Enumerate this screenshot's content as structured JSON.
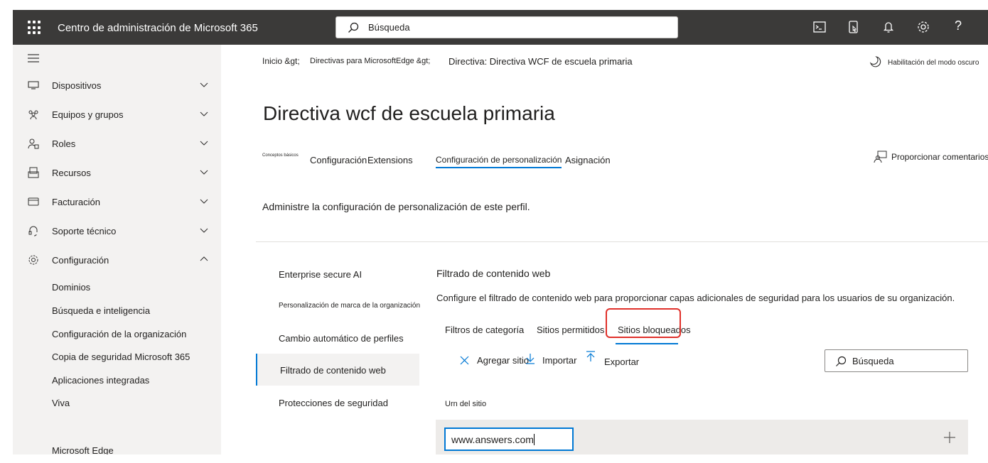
{
  "header": {
    "app_title": "Centro de administración de Microsoft 365",
    "search_placeholder": "Búsqueda",
    "icons": [
      "waffle-icon",
      "terminal-icon",
      "mobile-icon",
      "bell-icon",
      "gear-icon",
      "help-icon"
    ],
    "help_glyph": "?"
  },
  "nav": {
    "items": [
      {
        "label": "Dispositivos",
        "icon": "device-icon"
      },
      {
        "label": "Equipos y grupos",
        "icon": "group-icon"
      },
      {
        "label": "Roles",
        "icon": "roles-icon"
      },
      {
        "label": "Recursos",
        "icon": "resources-icon"
      },
      {
        "label": "Facturación",
        "icon": "billing-icon"
      },
      {
        "label": "Soporte técnico",
        "icon": "headset-icon"
      },
      {
        "label": "Configuración",
        "icon": "gear-icon"
      }
    ],
    "sub_items": [
      "Dominios",
      "Búsqueda e inteligencia",
      "Configuración de la organización",
      "Copia de seguridad Microsoft 365",
      "Aplicaciones integradas",
      "Viva",
      "Microsoft Edge"
    ]
  },
  "breadcrumb": {
    "home": "Inicio &gt;",
    "policies": "Directivas para MicrosoftEdge &gt;",
    "current": "Directiva: Directiva WCF de escuela primaria"
  },
  "dark_mode_label": "Habilitación del modo oscuro",
  "page_title": "Directiva wcf de escuela primaria",
  "tabs": {
    "basics": "Conceptos básicos",
    "settings": "Configuración",
    "extensions": "Extensions",
    "customization": "Configuración de personalización",
    "assignment": "Asignación"
  },
  "feedback_label": "Proporcionar comentarios",
  "description": "Administre la configuración de personalización de este perfil.",
  "sections": [
    "Enterprise secure AI",
    "Personalización de marca de la organización",
    "Cambio automático de perfiles",
    "Filtrado de contenido web",
    "Protecciones de seguridad"
  ],
  "panel": {
    "title": "Filtrado de contenido web",
    "description": "Configure el filtrado de contenido web para proporcionar capas adicionales de seguridad para los usuarios de su organización.",
    "tabs": [
      "Filtros de categoría",
      "Sitios permitidos",
      "Sitios bloqueados"
    ],
    "commands": {
      "add": "Agregar sitio",
      "import": "Importar",
      "export": "Exportar"
    },
    "search_placeholder": "Búsqueda",
    "column_header": "Urn del sitio",
    "row_value": "www.answers.com"
  },
  "colors": {
    "topbar": "#3b3a39",
    "nav_bg": "#f3f2f1",
    "accent": "#0078d4",
    "highlight": "#e0302a"
  }
}
